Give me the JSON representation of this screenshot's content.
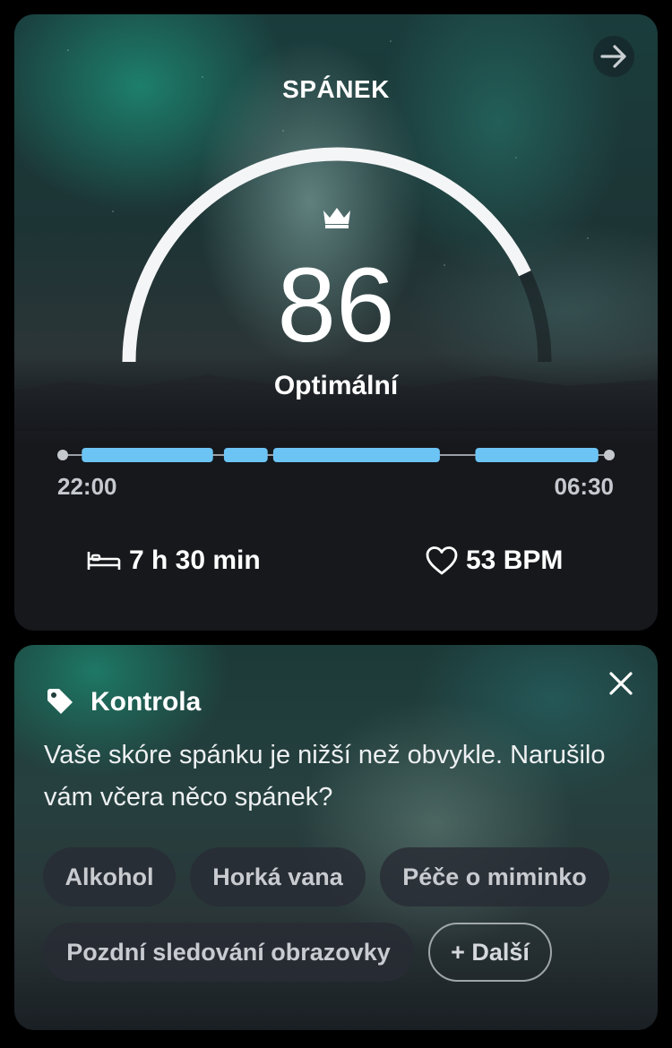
{
  "sleep_card": {
    "title": "SPÁNEK",
    "score": "86",
    "score_fraction": 0.86,
    "status": "Optimální",
    "timeline": {
      "start": "22:00",
      "end": "06:30",
      "segments_fraction": [
        [
          0.035,
          0.275
        ],
        [
          0.295,
          0.375
        ],
        [
          0.385,
          0.69
        ],
        [
          0.755,
          0.98
        ]
      ],
      "segment_color": "#6cc4f5"
    },
    "duration": "7 h 30 min",
    "heart_rate": "53 BPM",
    "icons": [
      "arrow-right-icon",
      "crown-icon",
      "bed-icon",
      "heart-icon"
    ]
  },
  "checkin_card": {
    "title": "Kontrola",
    "message": "Vaše skóre spánku je nižší než obvykle. Narušilo vám včera něco spánek?",
    "chips": [
      "Alkohol",
      "Horká vana",
      "Péče o miminko",
      "Pozdní sledování obrazovky"
    ],
    "more_label": "+ Další",
    "icons": [
      "tag-icon",
      "close-icon"
    ]
  }
}
